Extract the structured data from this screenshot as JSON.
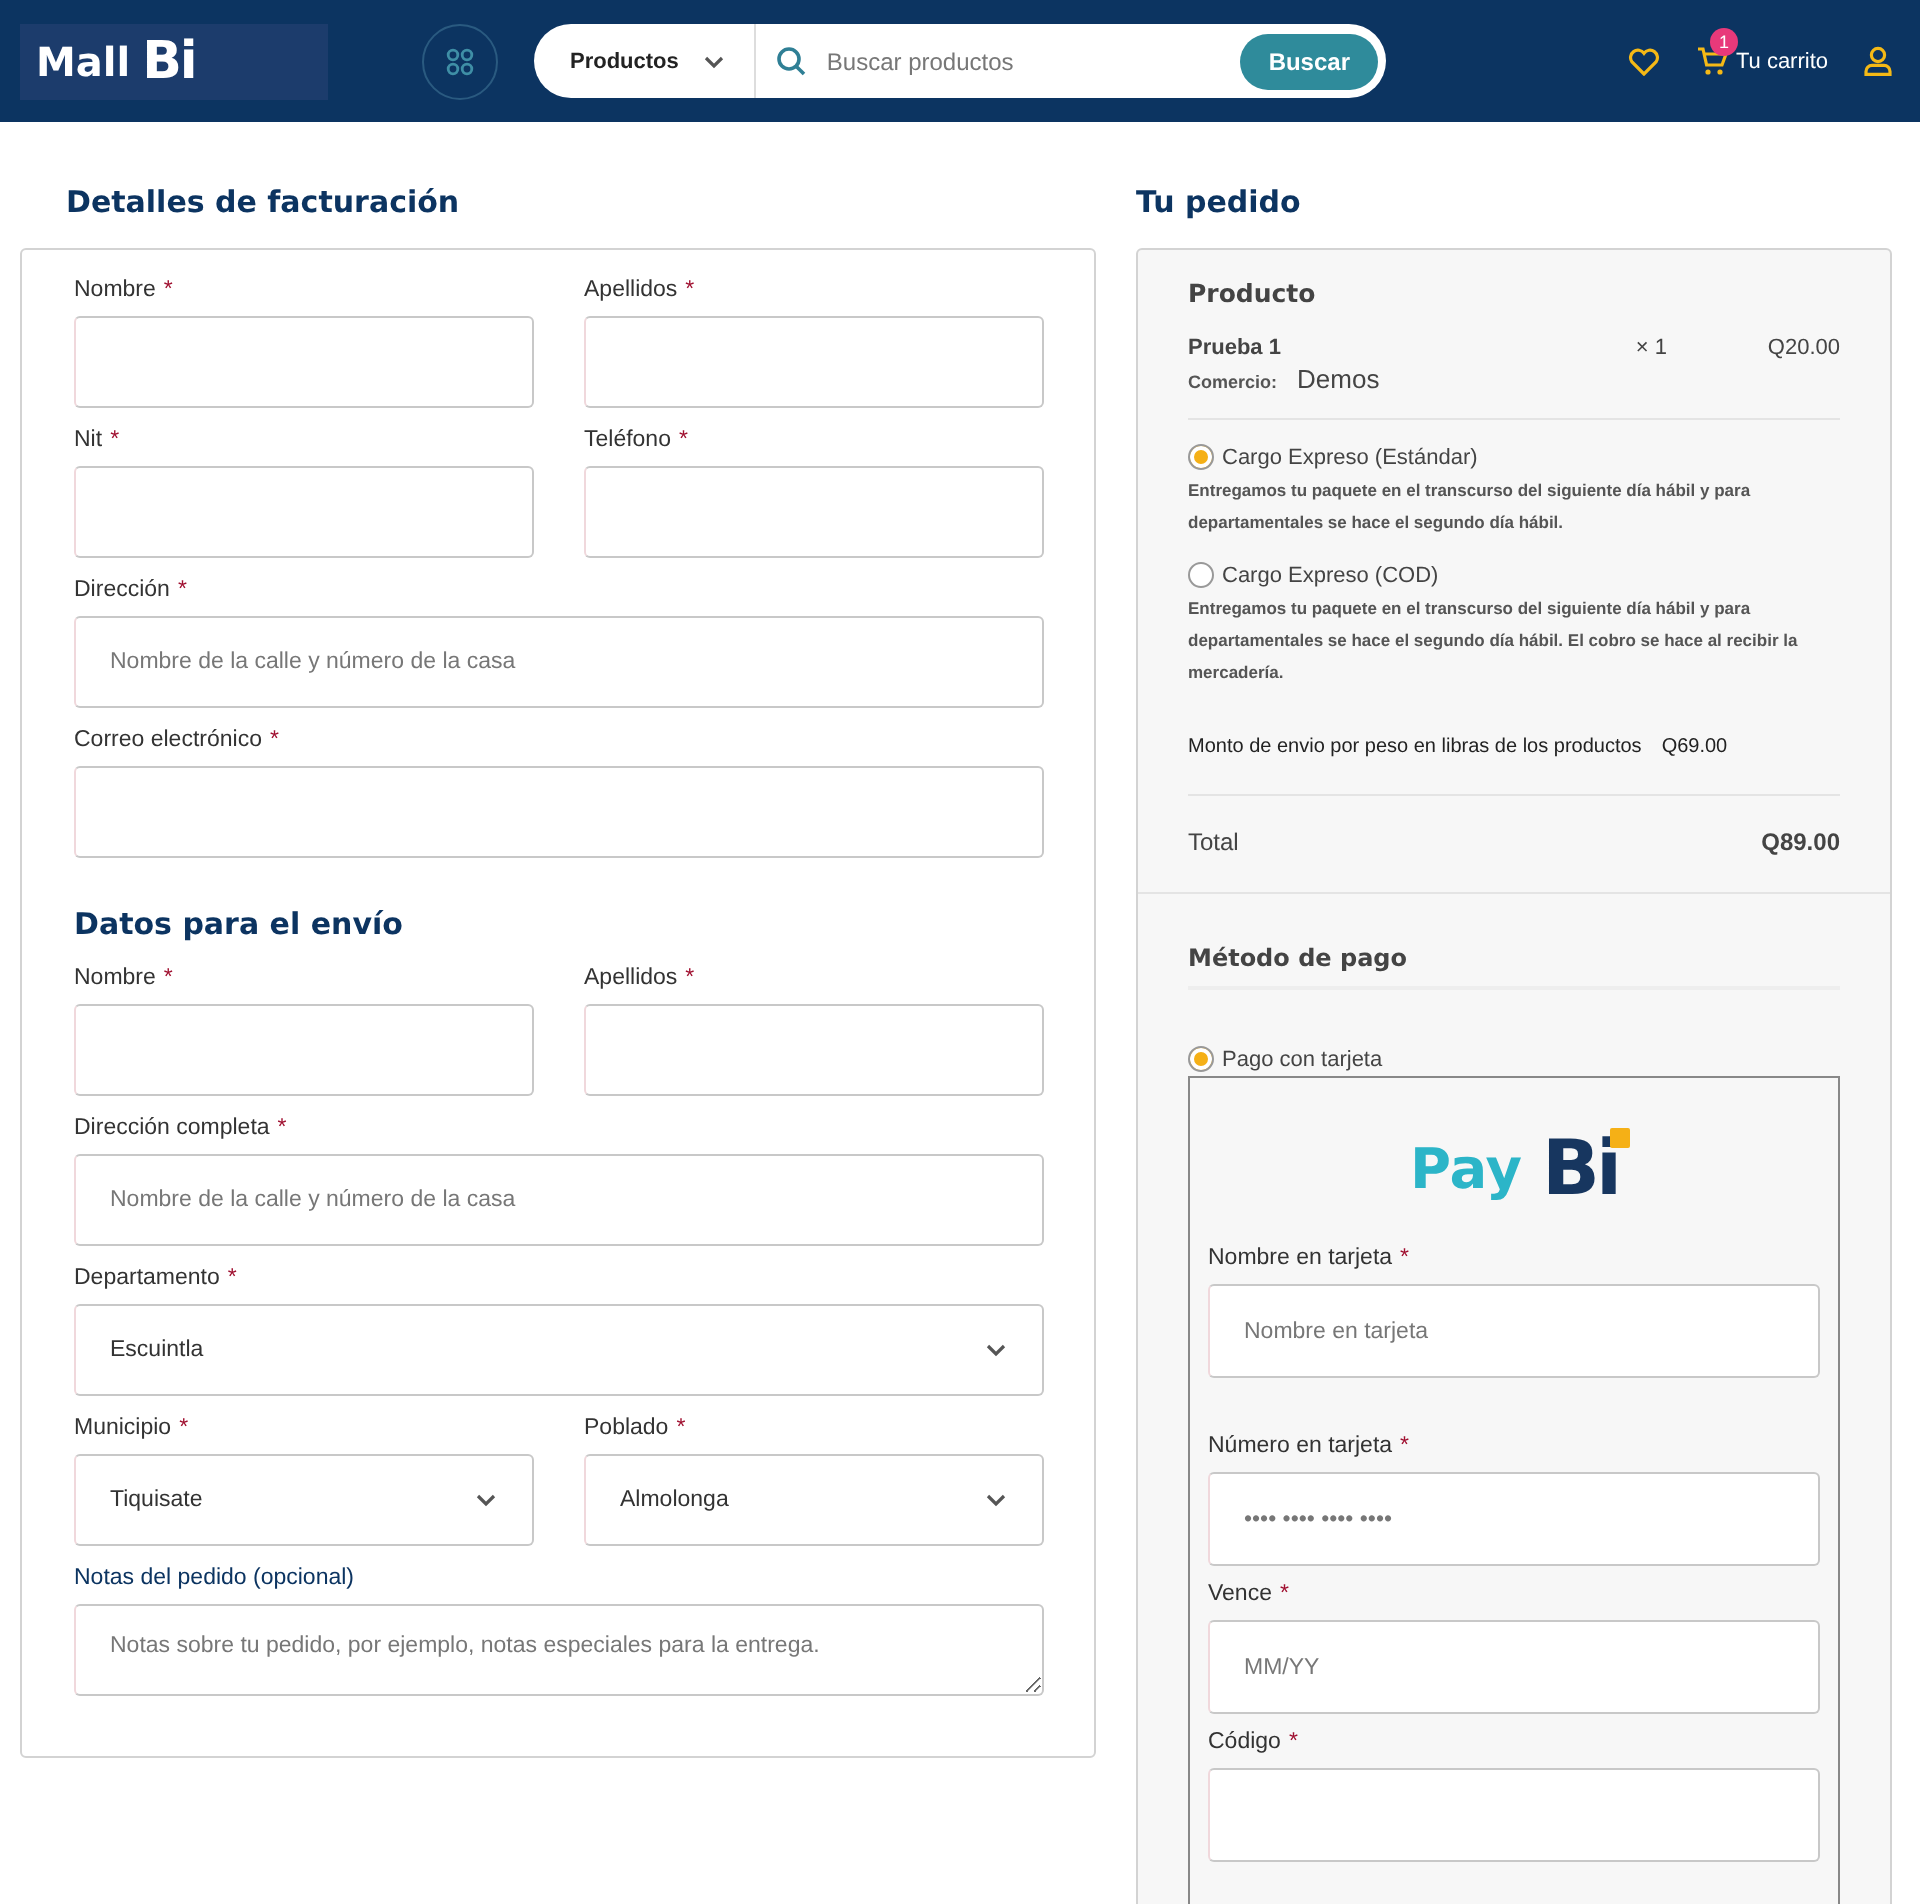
{
  "header": {
    "logo": {
      "word": "Mall",
      "mark": "Bi"
    },
    "category": "Productos",
    "search": {
      "placeholder": "Buscar productos"
    },
    "search_button": "Buscar",
    "cart": {
      "badge": "1",
      "label": "Tu carrito"
    }
  },
  "billing": {
    "title": "Detalles de facturación",
    "rows": [
      [
        {
          "kind": "text",
          "label": "Nombre",
          "asterisk": "*"
        },
        {
          "kind": "text",
          "label": "Apellidos",
          "asterisk": "*"
        }
      ],
      [
        {
          "kind": "text",
          "label": "Nit",
          "asterisk": "*"
        },
        {
          "kind": "text",
          "label": "Teléfono",
          "asterisk": "*"
        }
      ],
      [
        {
          "kind": "text",
          "label": "Dirección",
          "asterisk": "*",
          "placeholder": "Nombre de la calle y número de la casa"
        }
      ],
      [
        {
          "kind": "text",
          "label": "Correo electrónico",
          "asterisk": "*"
        }
      ]
    ]
  },
  "shipping": {
    "title": "Datos para el envío",
    "rows": [
      [
        {
          "kind": "text",
          "label": "Nombre",
          "asterisk": "*"
        },
        {
          "kind": "text",
          "label": "Apellidos",
          "asterisk": "*"
        }
      ],
      [
        {
          "kind": "text",
          "label": "Dirección completa",
          "asterisk": "*",
          "placeholder": "Nombre de la calle y número de la casa"
        }
      ],
      [
        {
          "kind": "select",
          "label": "Departamento",
          "asterisk": "*",
          "value": "Escuintla"
        }
      ],
      [
        {
          "kind": "select",
          "label": "Municipio",
          "asterisk": "*",
          "value": "Tiquisate"
        },
        {
          "kind": "select",
          "label": "Poblado",
          "asterisk": "*",
          "value": "Almolonga"
        }
      ],
      [
        {
          "kind": "textarea",
          "label": "Notas del pedido (opcional)",
          "placeholder": "Notas sobre tu pedido, por ejemplo, notas especiales para la entrega."
        }
      ]
    ]
  },
  "order": {
    "title": "Tu pedido",
    "column": "Producto",
    "item": {
      "name": "Prueba 1",
      "qty": "× 1",
      "price": "Q20.00",
      "merchant_label": "Comercio:",
      "merchant": "Demos"
    },
    "shipping_options": [
      {
        "label": "Cargo Expreso (Estándar)",
        "selected": true,
        "description": "Entregamos tu paquete en el transcurso del siguiente día hábil y para departamentales se hace el segundo día hábil."
      },
      {
        "label": "Cargo Expreso (COD)",
        "selected": false,
        "description": "Entregamos tu paquete en el transcurso del siguiente día hábil y para departamentales se hace el segundo día hábil. El cobro se hace al recibir la mercadería."
      }
    ],
    "shipping_cost": {
      "label": "Monto de envio por peso en libras de los productos",
      "value": "Q69.00"
    },
    "total": {
      "label": "Total",
      "value": "Q89.00"
    }
  },
  "payment": {
    "title": "Método de pago",
    "method": {
      "label": "Pago con tarjeta",
      "selected": true
    },
    "brand": {
      "word": "Pay",
      "mark": "Bi"
    },
    "fields": [
      {
        "label": "Nombre en tarjeta",
        "asterisk": "*",
        "placeholder": "Nombre en tarjeta"
      },
      {
        "label": "Número en tarjeta",
        "asterisk": "*",
        "placeholder": "•••• •••• •••• ••••"
      },
      {
        "label": "Vence",
        "asterisk": "*",
        "placeholder": "MM/YY"
      },
      {
        "label": "Código",
        "asterisk": "*"
      }
    ]
  }
}
